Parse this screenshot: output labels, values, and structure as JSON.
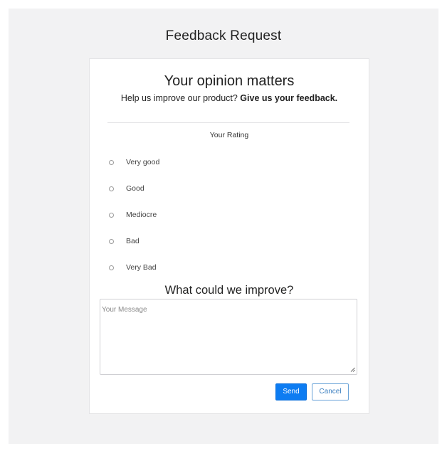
{
  "page": {
    "title": "Feedback Request"
  },
  "card": {
    "heading": "Your opinion matters",
    "subheading_plain": "Help us improve our product? ",
    "subheading_bold": "Give us your feedback."
  },
  "rating": {
    "label": "Your Rating",
    "options": [
      {
        "label": "Very good",
        "selected": false
      },
      {
        "label": "Good",
        "selected": false
      },
      {
        "label": "Mediocre",
        "selected": false
      },
      {
        "label": "Bad",
        "selected": false
      },
      {
        "label": "Very Bad",
        "selected": false
      }
    ]
  },
  "improve": {
    "heading": "What could we improve?",
    "message_value": "",
    "message_placeholder": "Your Message"
  },
  "actions": {
    "send_label": "Send",
    "cancel_label": "Cancel"
  },
  "colors": {
    "background": "#f2f2f3",
    "card": "#ffffff",
    "primary": "#0d7cf2",
    "cancel_text": "#3b7fc0"
  },
  "icons": {
    "radio": "radio-unchecked-icon",
    "resize": "resize-grip-icon"
  }
}
